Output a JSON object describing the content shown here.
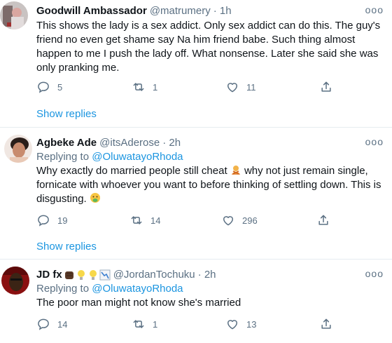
{
  "tweets": [
    {
      "name": "Goodwill Ambassador",
      "handle": "@matrumery",
      "time": "· 1h",
      "text": "This shows the lady is a sex addict. Only sex addict can do this. The guy's friend no even get shame say Na him friend babe. Such thing almost happen to me I push the lady off. What nonsense. Later she said she was only pranking me.",
      "replies": "5",
      "retweets": "1",
      "likes": "11",
      "show_replies": "Show replies"
    },
    {
      "name": "Agbeke Ade",
      "handle": "@itsAderose",
      "time": "· 2h",
      "replying_prefix": "Replying to ",
      "replying_to": "@OluwatayoRhoda",
      "text_part1": "Why exactly do married people still cheat",
      "text_part2": " why not just remain single, fornicate with whoever you want to before thinking of settling down. This is disgusting.",
      "replies": "19",
      "retweets": "14",
      "likes": "296",
      "show_replies": "Show replies"
    },
    {
      "name": "JD fx",
      "handle": "@JordanTochuku",
      "time": "· 2h",
      "replying_prefix": "Replying to ",
      "replying_to": "@OluwatayoRhoda",
      "text": "The poor man might not know she's married",
      "replies": "14",
      "retweets": "1",
      "likes": "13"
    }
  ],
  "more_label": "ooo",
  "colors": {
    "link": "#1b95e0",
    "secondary": "#5b7083",
    "divider": "#e6ecf0"
  },
  "icons": [
    "reply-icon",
    "retweet-icon",
    "like-icon",
    "share-icon",
    "more-icon"
  ]
}
